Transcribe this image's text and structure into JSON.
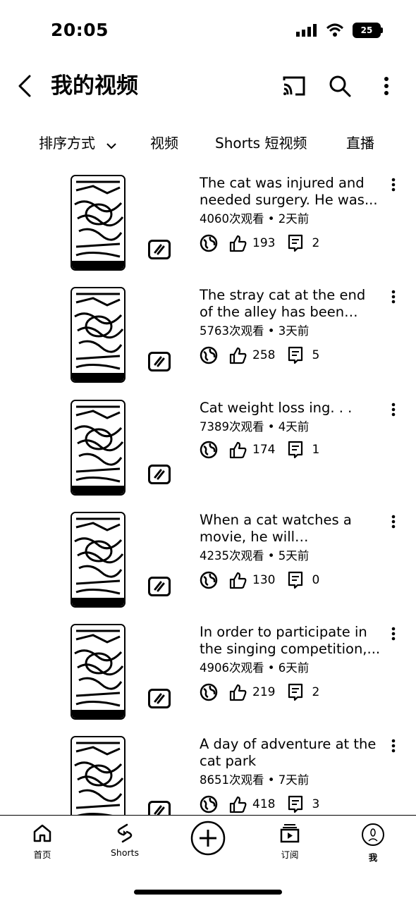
{
  "status_bar": {
    "time": "20:05",
    "battery": "25"
  },
  "header": {
    "title": "我的视频",
    "icons": [
      "back-icon",
      "cast-icon",
      "search-icon",
      "more-vert-icon"
    ]
  },
  "filters": {
    "sort_label": "排序方式",
    "tab_videos": "视频",
    "tab_shorts": "Shorts 短视频",
    "tab_live": "直播"
  },
  "videos": [
    {
      "title": "The cat was injured and needed surgery. He was...",
      "views": "4060次观看",
      "date": "2天前",
      "likes": "193",
      "comments": "2"
    },
    {
      "title": "The stray cat at the end of the alley has been taken i...",
      "views": "5763次观看",
      "date": "3天前",
      "likes": "258",
      "comments": "5"
    },
    {
      "title": "Cat weight loss ing. . .",
      "views": "7389次观看",
      "date": "4天前",
      "likes": "174",
      "comments": "1"
    },
    {
      "title": "When a cat watches a movie, he will sometimes...",
      "views": "4235次观看",
      "date": "5天前",
      "likes": "130",
      "comments": "0"
    },
    {
      "title": "In order to participate in the singing competition,...",
      "views": "4906次观看",
      "date": "6天前",
      "likes": "219",
      "comments": "2"
    },
    {
      "title": "A day of adventure at the cat park",
      "views": "8651次观看",
      "date": "7天前",
      "likes": "418",
      "comments": "3"
    }
  ],
  "meta_separator": " • ",
  "bottom_nav": {
    "home": "首页",
    "shorts": "Shorts",
    "subscriptions": "订阅",
    "me": "我"
  }
}
